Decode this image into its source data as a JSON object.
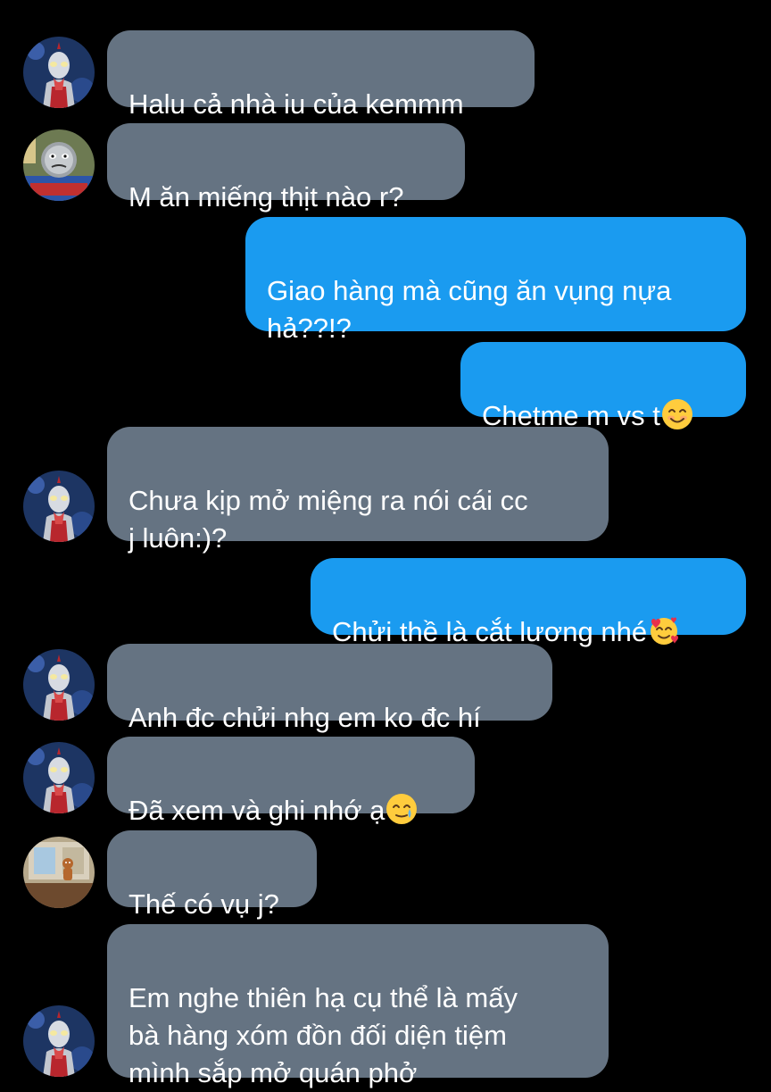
{
  "messages": [
    {
      "id": "m1",
      "direction": "in",
      "avatar": "ultraman-avatar",
      "text": "Halu cả nhà iu của kemmm"
    },
    {
      "id": "m2",
      "direction": "in",
      "avatar": "thomas-train-avatar",
      "text": "M ăn miếng thịt nào r?"
    },
    {
      "id": "m3",
      "direction": "out",
      "text": "Giao hàng mà cũng ăn vụng nựa\nhả??!?"
    },
    {
      "id": "m4",
      "direction": "out",
      "text": "Chetme m vs t",
      "emoji": "smiling-face-emoji"
    },
    {
      "id": "m5",
      "direction": "in",
      "avatar": "ultraman-avatar",
      "text": "Chưa kịp mở miệng ra nói cái cc\nj luôn:)?"
    },
    {
      "id": "m6",
      "direction": "out",
      "text": "Chửi thề là cắt lương nhé",
      "emoji": "smiling-face-with-hearts-emoji"
    },
    {
      "id": "m7",
      "direction": "in",
      "avatar": "ultraman-avatar",
      "text": "Anh đc chửi nhg em ko đc hí"
    },
    {
      "id": "m8",
      "direction": "in",
      "avatar": "ultraman-avatar",
      "text": "Đã xem và ghi nhớ ạ",
      "emoji": "smiling-face-with-tear-emoji"
    },
    {
      "id": "m9",
      "direction": "in",
      "avatar": "gingerbread-avatar",
      "text": "Thế có vụ j?"
    },
    {
      "id": "m10",
      "direction": "in",
      "avatar": "ultraman-avatar",
      "text": "Em nghe thiên hạ cụ thể là mấy\nbà hàng xóm đồn đối diện tiệm\nmình sắp mở quán phở"
    }
  ],
  "colors": {
    "background": "#000000",
    "incoming_bubble": "#657382",
    "outgoing_bubble": "#1a9bf0",
    "text": "#ffffff"
  }
}
